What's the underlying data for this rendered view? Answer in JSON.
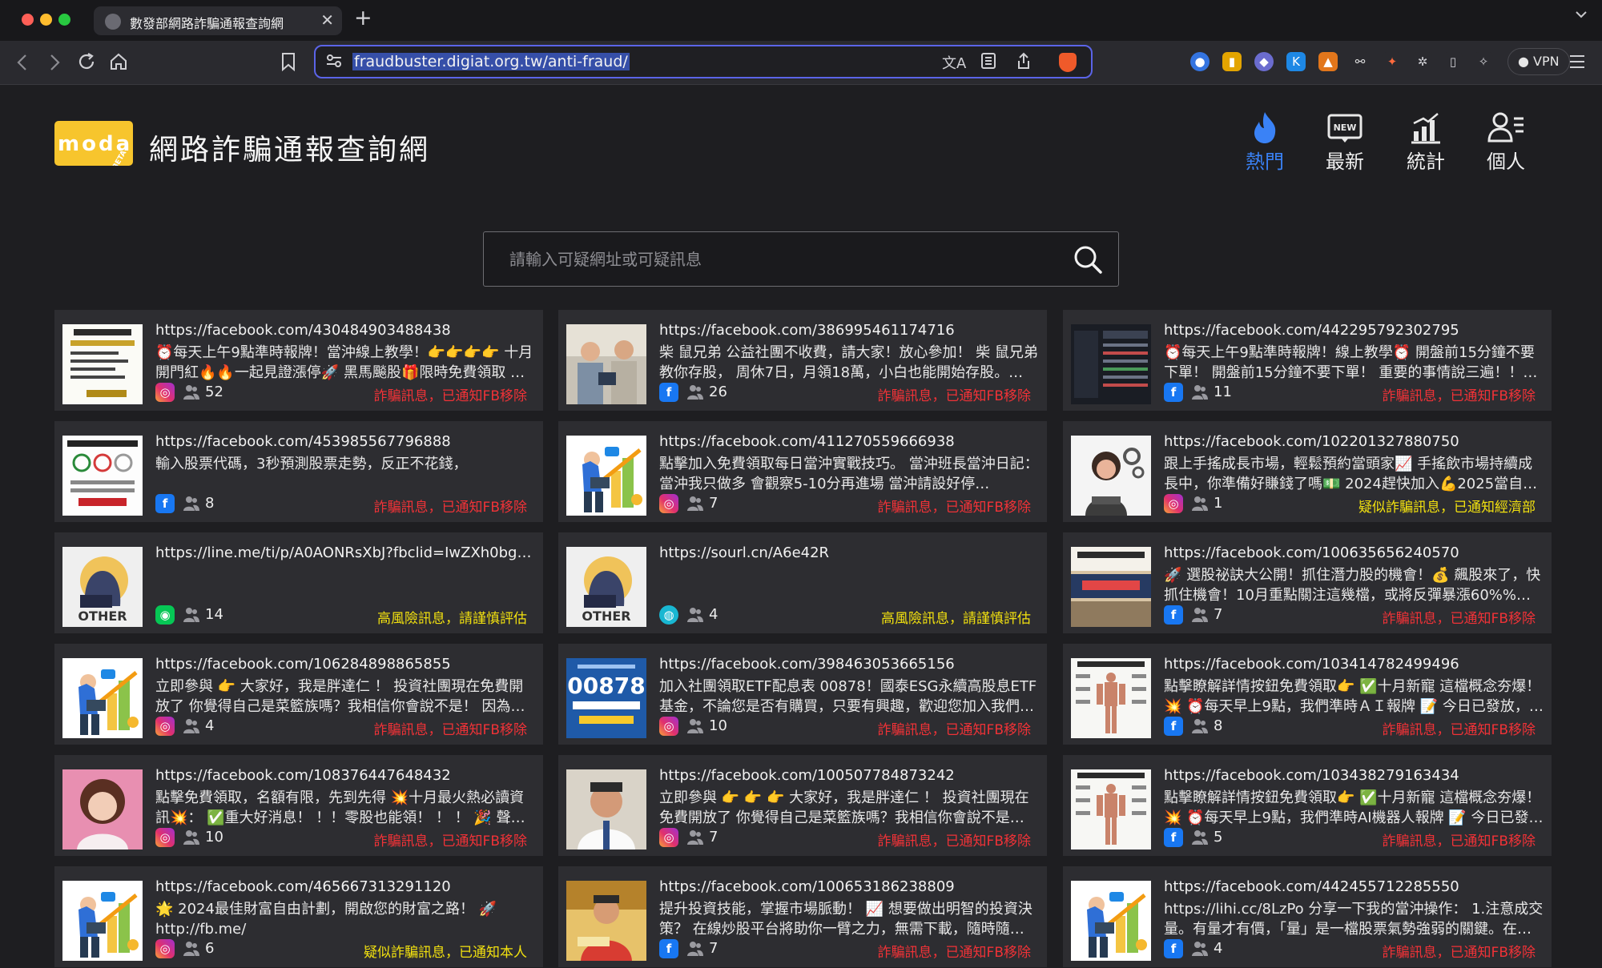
{
  "browser": {
    "tab_title": "數發部網路詐騙通報查詢網",
    "tab_close": "✕",
    "new_tab": "+",
    "url": "fraudbuster.digiat.org.tw/anti-fraud/",
    "vpn_label": "VPN"
  },
  "site": {
    "logo_text": "moda",
    "logo_badge": "BETA",
    "title": "網路詐騙通報查詢網",
    "nav": [
      {
        "label": "熱門",
        "icon": "fire-icon",
        "active": true
      },
      {
        "label": "最新",
        "icon": "new-badge-icon",
        "active": false
      },
      {
        "label": "統計",
        "icon": "bar-chart-icon",
        "active": false
      },
      {
        "label": "個人",
        "icon": "user-list-icon",
        "active": false
      }
    ],
    "search_placeholder": "請輸入可疑網址或可疑訊息"
  },
  "colors": {
    "accent_blue": "#3a82f6",
    "status_red": "#f03237",
    "status_yellow": "#f2e10f",
    "card_bg": "#2d2d31"
  },
  "reports": [
    {
      "url": "https://facebook.com/430484903488438",
      "text": "⏰每天上午9點準時報牌！當沖線上教學！👉👉👉👉 十月開門紅🔥🔥一起見證漲停🚀 黑馬飈股🎁限時免費領取 這三…",
      "platform": "instagram",
      "count": "52",
      "status": "詐騙訊息，已通知FB移除",
      "level": "red",
      "thumb": "doc"
    },
    {
      "url": "https://facebook.com/386995461174716",
      "text": "柴 鼠兄弟 公益社團不收費，請大家！放心參加！ 柴 鼠兄弟教你存股， 周休7日，月領18萬，小白也能開始存股。…",
      "platform": "facebook",
      "count": "26",
      "status": "詐騙訊息，已通知FB移除",
      "level": "red",
      "thumb": "photo-men"
    },
    {
      "url": "https://facebook.com/442295792302795",
      "text": "⏰每天上午9點準時報牌！線上教學⏰ 開盤前15分鐘不要下單！ 開盤前15分鐘不要下單！ 重要的事情說三遍！！！ …",
      "platform": "facebook",
      "count": "11",
      "status": "詐騙訊息，已通知FB移除",
      "level": "red",
      "thumb": "screen"
    },
    {
      "url": "https://facebook.com/453985567796888",
      "text": "輸入股票代碼，3秒預測股票走勢，反正不花錢，",
      "platform": "facebook",
      "count": "8",
      "status": "詐騙訊息，已通知FB移除",
      "level": "red",
      "thumb": "doc2"
    },
    {
      "url": "https://facebook.com/411270559666938",
      "text": "點擊加入免費領取每日當沖實戰技巧。 當沖班長當沖日記： 當沖我只做多 會觀察5-10分再進場 當沖請設好停…",
      "platform": "instagram",
      "count": "7",
      "status": "詐騙訊息，已通知FB移除",
      "level": "red",
      "thumb": "illus"
    },
    {
      "url": "https://facebook.com/102201327880750",
      "text": "跟上手搖成長市場，輕鬆預約當頭家📈 手搖飲市場持續成長中，你準備好賺錢了嗎💵 2024趕快加入💪2025當自己…",
      "platform": "instagram",
      "count": "1",
      "status": "疑似詐騙訊息，已通知經濟部",
      "level": "yellow",
      "thumb": "support"
    },
    {
      "url": "https://line.me/ti/p/A0AONRsXbJ?fbclid=IwZXh0bgN…",
      "text": "",
      "platform": "line",
      "count": "14",
      "status": "高風險訊息，請謹慎評估",
      "level": "yellow",
      "thumb": "other"
    },
    {
      "url": "https://sourl.cn/A6e42R",
      "text": "",
      "platform": "web",
      "count": "4",
      "status": "高風險訊息，請謹慎評估",
      "level": "yellow",
      "thumb": "other"
    },
    {
      "url": "https://facebook.com/100635656240570",
      "text": "🚀 選股祕訣大公開！抓住潛力股的機會！💰 飆股來了，快抓住機會！10月重點關注這幾檔，或將反彈暴漲60%%…",
      "platform": "facebook",
      "count": "7",
      "status": "詐騙訊息，已通知FB移除",
      "level": "red",
      "thumb": "banner"
    },
    {
      "url": "https://facebook.com/106284898865855",
      "text": "立即參與 👉 大家好，我是胖達仁 ！ 投資社團現在免費開放了 你覺得自己是菜籃族嗎？我相信你會說不是！ 因為…",
      "platform": "instagram",
      "count": "4",
      "status": "詐騙訊息，已通知FB移除",
      "level": "red",
      "thumb": "illus"
    },
    {
      "url": "https://facebook.com/398463053665156",
      "text": "加入社團領取ETF配息表 00878！國泰ESG永續高股息ETF基金，不論您是否有購買，只要有興趣，歡迎您加入我們…",
      "platform": "instagram",
      "count": "10",
      "status": "詐騙訊息，已通知FB移除",
      "level": "red",
      "thumb": "etf"
    },
    {
      "url": "https://facebook.com/103414782499496",
      "text": "點擊瞭解詳情按鈕免費領取👉 ✅十月新寵 這檔概念夯爆！💥 ⏰每天早上9點，我們準時ＡＩ報牌 📝 今日已發放，…",
      "platform": "facebook",
      "count": "8",
      "status": "詐騙訊息，已通知FB移除",
      "level": "red",
      "thumb": "anatomy"
    },
    {
      "url": "https://facebook.com/108376447648432",
      "text": "點擊免費領取，名額有限，先到先得 💥十月最火熱必讀資訊💥： ✅重大好消息！ ！！零股也能領！ ！ ！ 🎉 聲明…",
      "platform": "instagram",
      "count": "10",
      "status": "詐騙訊息，已通知FB移除",
      "level": "red",
      "thumb": "woman"
    },
    {
      "url": "https://facebook.com/100507784873242",
      "text": "立即參與 👉 👉 👉 大家好，我是胖達仁 ！ 投資社團現在免費開放了 你覺得自己是菜籃族嗎？我相信你會說不是…",
      "platform": "instagram",
      "count": "7",
      "status": "詐騙訊息，已通知FB移除",
      "level": "red",
      "thumb": "man"
    },
    {
      "url": "https://facebook.com/103438279163434",
      "text": "點擊瞭解詳情按鈕免費領取👉 ✅十月新寵 這檔概念夯爆！💥 ⏰每天早上9點，我們準時AI機器人報牌 📝 今日已發…",
      "platform": "facebook",
      "count": "5",
      "status": "詐騙訊息，已通知FB移除",
      "level": "red",
      "thumb": "anatomy"
    },
    {
      "url": "https://facebook.com/465667313291120",
      "text": "🌟 2024最佳財富自由計劃，開啟您的財富之路！ 🚀 http://fb.me/",
      "platform": "instagram",
      "count": "6",
      "status": "疑似詐騙訊息，已通知本人",
      "level": "yellow",
      "thumb": "illus"
    },
    {
      "url": "https://facebook.com/100653186238809",
      "text": "提升投資技能，掌握市場脈動！ 📈 想要做出明智的投資決策？ 在線炒股平台將助你一臂之力，無需下載，隨時隨…",
      "platform": "facebook",
      "count": "7",
      "status": "詐騙訊息，已通知FB移除",
      "level": "red",
      "thumb": "speaker"
    },
    {
      "url": "https://facebook.com/442455712285550",
      "text": "https://lihi.cc/8LzPo 分享一下我的當沖操作： 1.注意成交量。有量才有價，「量」是一檔股票氣勢強弱的關鍵。在…",
      "platform": "facebook",
      "count": "4",
      "status": "詐騙訊息，已通知FB移除",
      "level": "red",
      "thumb": "illus"
    }
  ]
}
